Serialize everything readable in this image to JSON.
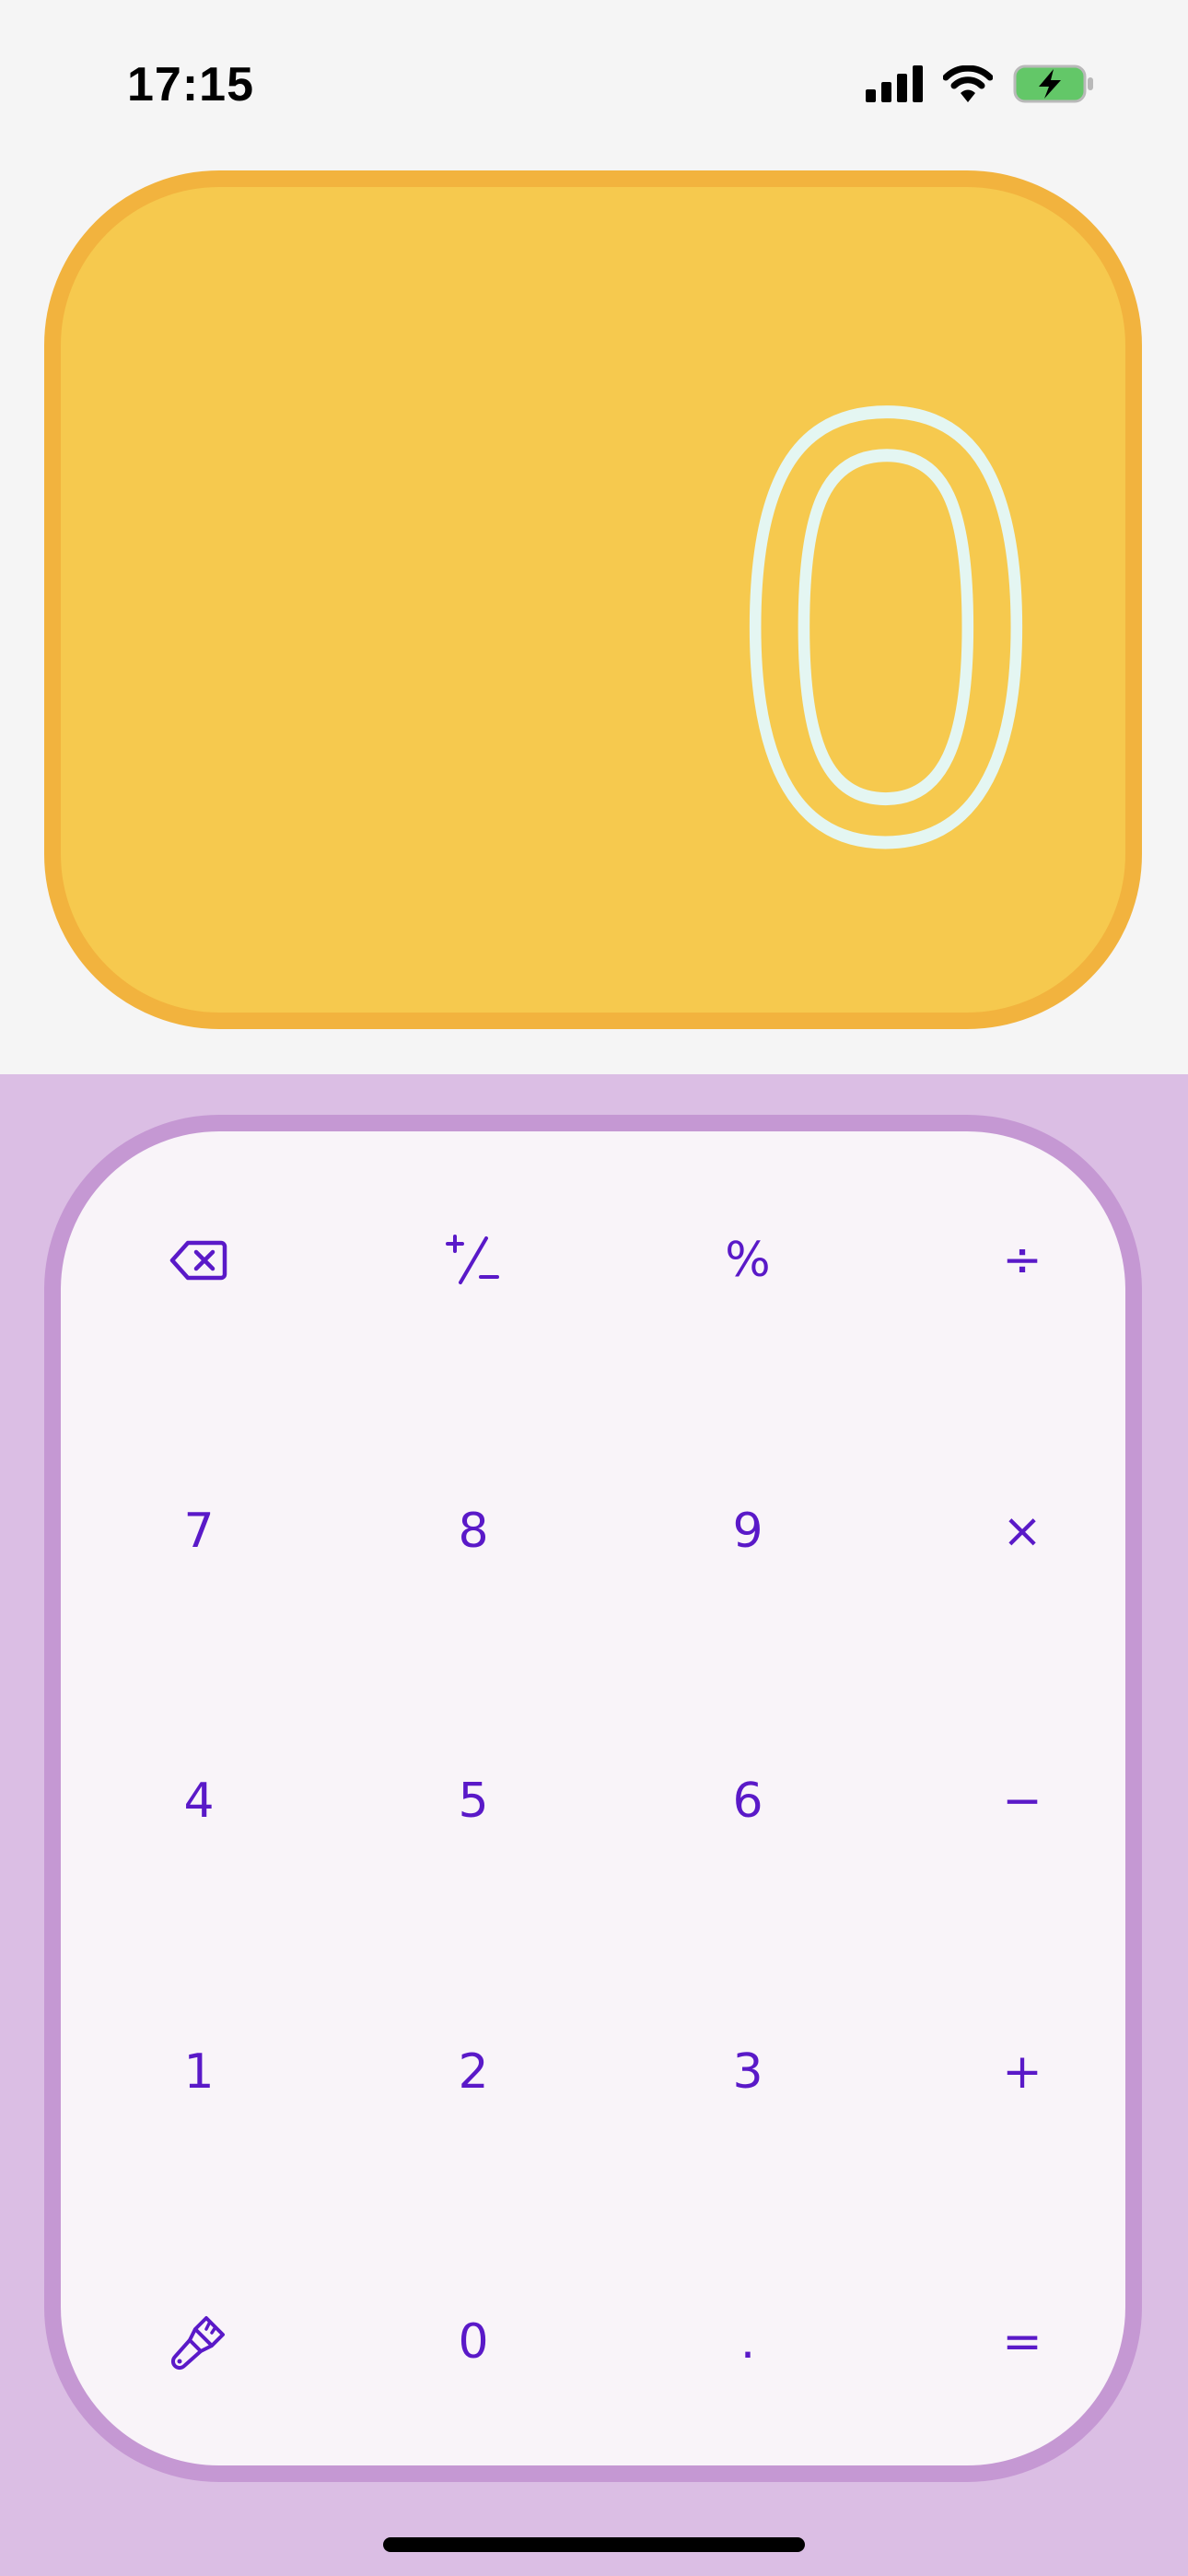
{
  "status_bar": {
    "time": "17:15",
    "icons": [
      "signal-icon",
      "wifi-icon",
      "battery-charging-icon"
    ]
  },
  "display": {
    "value": "0",
    "card_color": "#F6C94E",
    "card_border": "#F2B33E",
    "digit_color": "#E4F6F2"
  },
  "keypad": {
    "accent_color": "#5A19C8",
    "rows": [
      [
        {
          "label": "backspace",
          "icon": "backspace-icon"
        },
        {
          "label": "+/−",
          "icon": "plus-minus-icon"
        },
        {
          "label": "%"
        },
        {
          "label": "÷"
        }
      ],
      [
        {
          "label": "7"
        },
        {
          "label": "8"
        },
        {
          "label": "9"
        },
        {
          "label": "×"
        }
      ],
      [
        {
          "label": "4"
        },
        {
          "label": "5"
        },
        {
          "label": "6"
        },
        {
          "label": "−"
        }
      ],
      [
        {
          "label": "1"
        },
        {
          "label": "2"
        },
        {
          "label": "3"
        },
        {
          "label": "+"
        }
      ],
      [
        {
          "label": "theme",
          "icon": "paintbrush-icon"
        },
        {
          "label": "0"
        },
        {
          "label": "."
        },
        {
          "label": "="
        }
      ]
    ]
  }
}
